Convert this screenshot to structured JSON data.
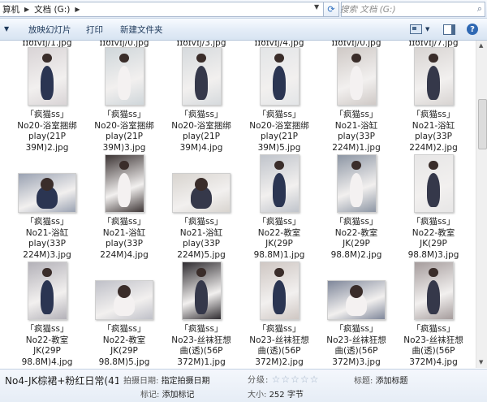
{
  "address": {
    "crumbs": [
      "算机",
      "文档 (G:)"
    ],
    "search_placeholder": "搜索 文档 (G:)"
  },
  "toolbar": {
    "slideshow": "放映幻灯片",
    "print": "打印",
    "new_folder": "新建文件夹"
  },
  "top_sliver": [
    "ɪɪʊɪvɪj/1.jpg",
    "ɪɪʊɪvɪj/0.jpg",
    "ɪɪʊɪvɪj/3.jpg",
    "ɪɪʊɪvɪj/4.jpg",
    "ɪɪʊɪvɪj/0.jpg",
    "ɪɪʊɪvɪj/7.jpg"
  ],
  "files": [
    {
      "lines": [
        "「疯猫ss」",
        "No20-浴室捆绑",
        "play(21P",
        "39M)2.jpg"
      ]
    },
    {
      "lines": [
        "「疯猫ss」",
        "No20-浴室捆绑",
        "play(21P",
        "39M)3.jpg"
      ]
    },
    {
      "lines": [
        "「疯猫ss」",
        "No20-浴室捆绑",
        "play(21P",
        "39M)4.jpg"
      ]
    },
    {
      "lines": [
        "「疯猫ss」",
        "No20-浴室捆绑",
        "play(21P",
        "39M)5.jpg"
      ]
    },
    {
      "lines": [
        "「疯猫ss」",
        "No21-浴缸",
        "play(33P",
        "224M)1.jpg"
      ]
    },
    {
      "lines": [
        "「疯猫ss」",
        "No21-浴缸",
        "play(33P",
        "224M)2.jpg"
      ]
    },
    {
      "lines": [
        "「疯猫ss」",
        "No21-浴缸",
        "play(33P",
        "224M)3.jpg"
      ]
    },
    {
      "lines": [
        "「疯猫ss」",
        "No21-浴缸",
        "play(33P",
        "224M)4.jpg"
      ]
    },
    {
      "lines": [
        "「疯猫ss」",
        "No21-浴缸",
        "play(33P",
        "224M)5.jpg"
      ]
    },
    {
      "lines": [
        "「疯猫ss」",
        "No22-教室",
        "JK(29P",
        "98.8M)1.jpg"
      ]
    },
    {
      "lines": [
        "「疯猫ss」",
        "No22-教室",
        "JK(29P",
        "98.8M)2.jpg"
      ]
    },
    {
      "lines": [
        "「疯猫ss」",
        "No22-教室",
        "JK(29P",
        "98.8M)3.jpg"
      ]
    },
    {
      "lines": [
        "「疯猫ss」",
        "No22-教室",
        "JK(29P",
        "98.8M)4.jpg"
      ]
    },
    {
      "lines": [
        "「疯猫ss」",
        "No22-教室",
        "JK(29P",
        "98.8M)5.jpg"
      ]
    },
    {
      "lines": [
        "「疯猫ss」",
        "No23-丝袜狂想",
        "曲(透)(56P",
        "372M)1.jpg"
      ]
    },
    {
      "lines": [
        "「疯猫ss」",
        "No23-丝袜狂想",
        "曲(透)(56P",
        "372M)2.jpg"
      ]
    },
    {
      "lines": [
        "「疯猫ss」",
        "No23-丝袜狂想",
        "曲(透)(56P",
        "372M)3.jpg"
      ]
    },
    {
      "lines": [
        "「疯猫ss」",
        "No23-丝袜狂想",
        "曲(透)(56P",
        "372M)4.jpg"
      ]
    }
  ],
  "details": {
    "filename": "No4-JK棕裙+粉红日常(41P 2...",
    "date_key": "拍摄日期:",
    "date_value": "指定拍摄日期",
    "tags_key": "标记:",
    "tags_value": "添加标记",
    "rating_key": "分级:",
    "stars": "☆☆☆☆☆",
    "size_key": "大小:",
    "size_value": "252 字节",
    "title_key": "标题:",
    "title_value": "添加标题"
  },
  "colors": {
    "toolbar_text": "#1e395b",
    "accent": "#2e68b3"
  }
}
